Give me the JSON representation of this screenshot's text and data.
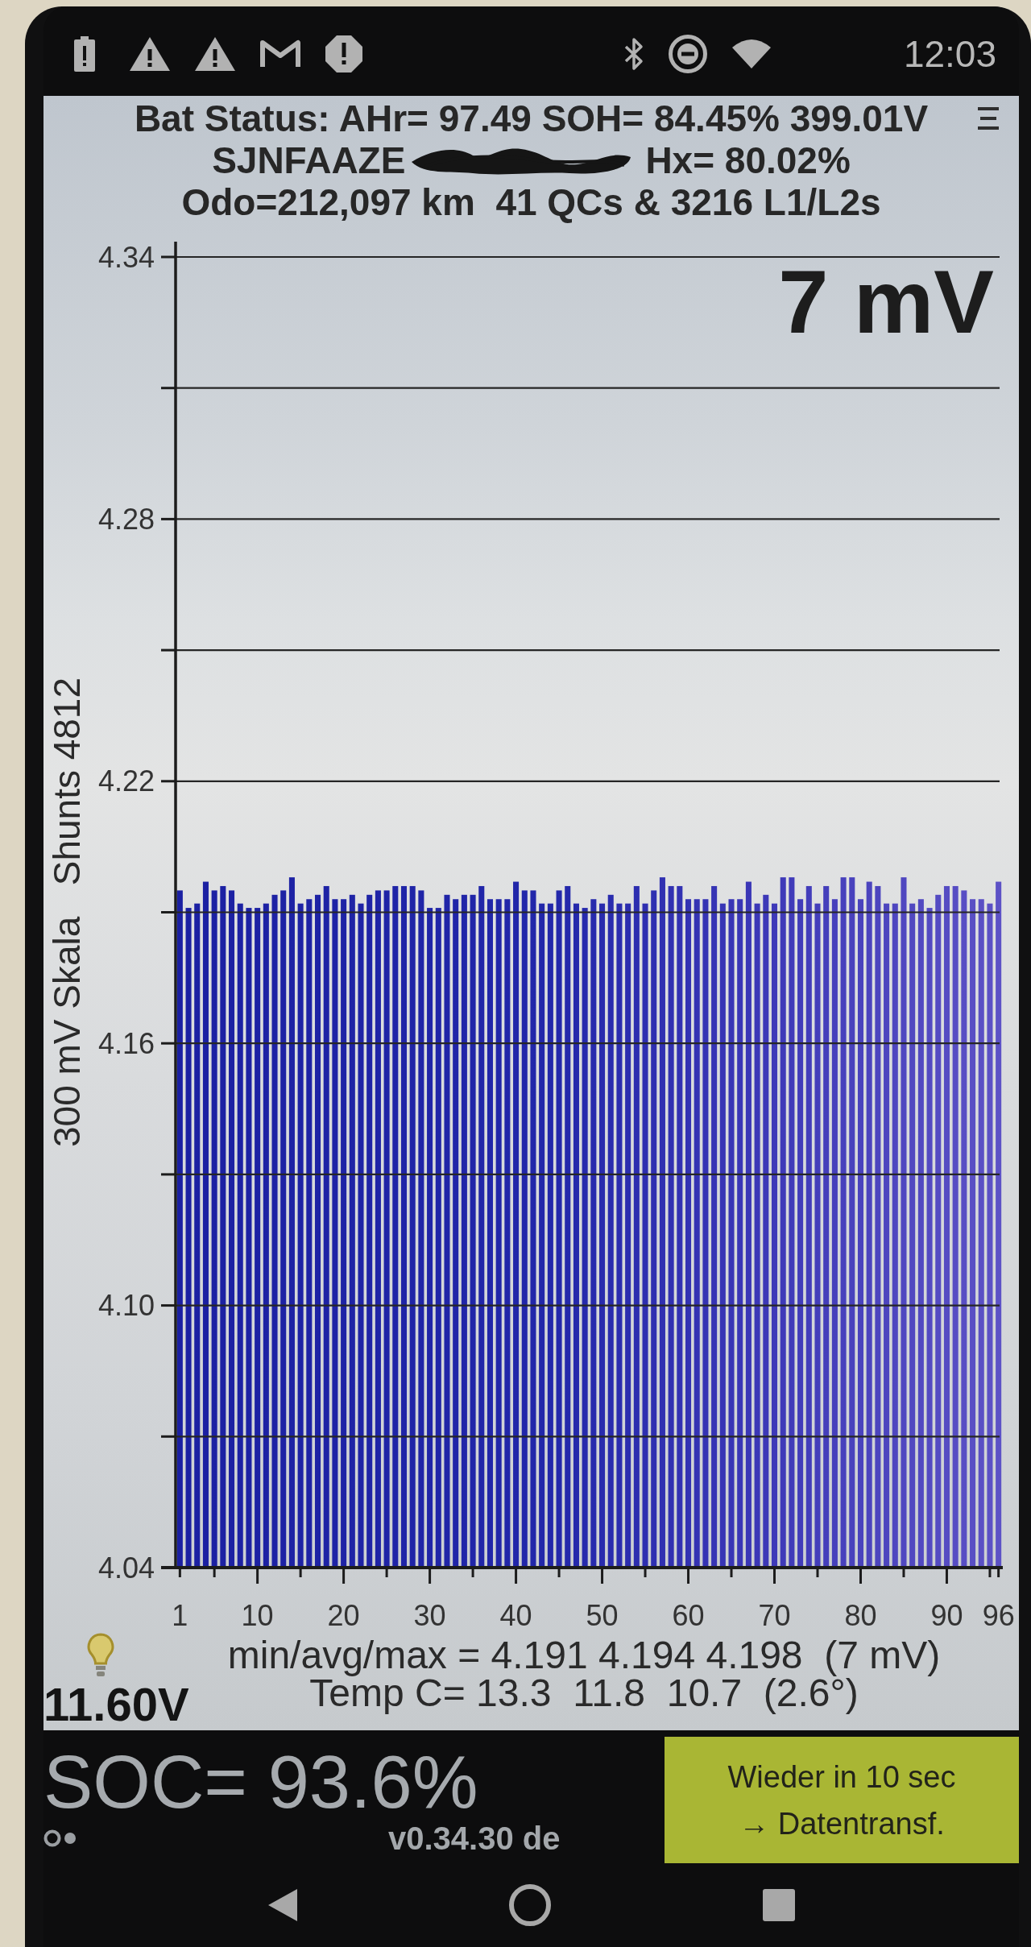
{
  "status_bar": {
    "time": "12:03"
  },
  "header": {
    "battery_status": "Bat Status: AHr= 97.49 SOH= 84.45% 399.01V",
    "vin": "SJNFAAZE",
    "hx": "Hx= 80.02%",
    "odometer": "Odo=212,097 km  41 QCs & 3216 L1/L2s"
  },
  "cell_voltage_chart": {
    "spread_reading": "7 mV",
    "chart_data": {
      "type": "bar",
      "ylabel": "300 mV Skala   Shunts 4812",
      "x": [
        1,
        2,
        3,
        4,
        5,
        6,
        7,
        8,
        9,
        10,
        11,
        12,
        13,
        14,
        15,
        16,
        17,
        18,
        19,
        20,
        21,
        22,
        23,
        24,
        25,
        26,
        27,
        28,
        29,
        30,
        31,
        32,
        33,
        34,
        35,
        36,
        37,
        38,
        39,
        40,
        41,
        42,
        43,
        44,
        45,
        46,
        47,
        48,
        49,
        50,
        51,
        52,
        53,
        54,
        55,
        56,
        57,
        58,
        59,
        60,
        61,
        62,
        63,
        64,
        65,
        66,
        67,
        68,
        69,
        70,
        71,
        72,
        73,
        74,
        75,
        76,
        77,
        78,
        79,
        80,
        81,
        82,
        83,
        84,
        85,
        86,
        87,
        88,
        89,
        90,
        91,
        92,
        93,
        94,
        95,
        96
      ],
      "values": [
        4.195,
        4.191,
        4.192,
        4.197,
        4.195,
        4.196,
        4.195,
        4.192,
        4.191,
        4.191,
        4.192,
        4.194,
        4.195,
        4.198,
        4.192,
        4.193,
        4.194,
        4.196,
        4.193,
        4.193,
        4.194,
        4.192,
        4.194,
        4.195,
        4.195,
        4.196,
        4.196,
        4.196,
        4.195,
        4.191,
        4.191,
        4.194,
        4.193,
        4.194,
        4.194,
        4.196,
        4.193,
        4.193,
        4.193,
        4.197,
        4.195,
        4.195,
        4.192,
        4.192,
        4.195,
        4.196,
        4.192,
        4.191,
        4.193,
        4.192,
        4.194,
        4.192,
        4.192,
        4.196,
        4.192,
        4.195,
        4.198,
        4.196,
        4.196,
        4.193,
        4.193,
        4.193,
        4.196,
        4.192,
        4.193,
        4.193,
        4.197,
        4.192,
        4.194,
        4.192,
        4.198,
        4.198,
        4.193,
        4.196,
        4.192,
        4.196,
        4.193,
        4.198,
        4.198,
        4.193,
        4.197,
        4.196,
        4.192,
        4.192,
        4.198,
        4.192,
        4.193,
        4.191,
        4.194,
        4.196,
        4.196,
        4.195,
        4.193,
        4.193,
        4.192,
        4.197
      ],
      "xlim": [
        0.5,
        96.5
      ],
      "ylim": [
        4.04,
        4.34
      ],
      "xticks": [
        1,
        10,
        20,
        30,
        40,
        50,
        60,
        70,
        80,
        90,
        96
      ],
      "yticks": [
        4.04,
        {
          "value": 4.1,
          "label": "4.10"
        },
        4.16,
        4.22,
        4.28,
        4.34
      ],
      "grid": true
    }
  },
  "summary": {
    "min_avg_max": "min/avg/max = 4.191 4.194 4.198  (7 mV)",
    "temperature": "Temp C= 13.3  11.8  10.7  (2.6°)",
    "aux_battery": "11.60V"
  },
  "footer": {
    "soc": "SOC= 93.6%",
    "version": "v0.34.30 de",
    "retry_button": [
      "Wieder in 10 sec",
      "→ Datentransf."
    ]
  }
}
